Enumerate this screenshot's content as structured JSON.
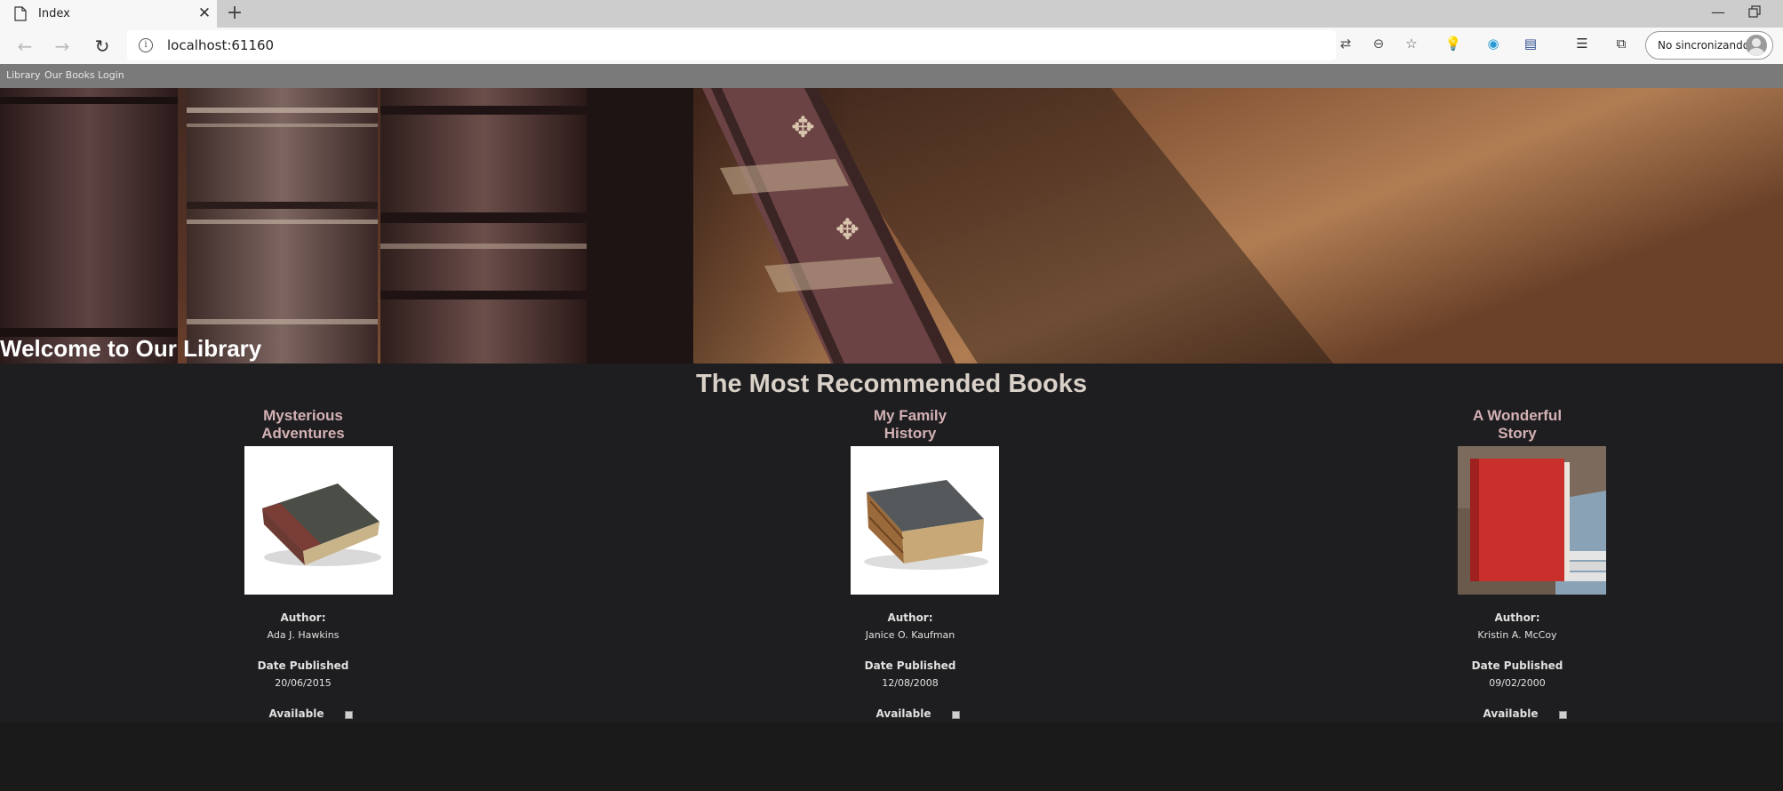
{
  "browser": {
    "tab_title": "Index",
    "url": "localhost:61160",
    "sync_label": "No sincronizando"
  },
  "site": {
    "nav": [
      {
        "label": "Library"
      },
      {
        "label": "Our Books"
      },
      {
        "label": "Login"
      }
    ],
    "hero_title": "Welcome to Our Library",
    "section_title": "The Most Recommended Books",
    "author_label": "Author:",
    "date_label": "Date Published",
    "available_label": "Available"
  },
  "books": [
    {
      "title_line1": "Mysterious",
      "title_line2": "Adventures",
      "author": "Ada J. Hawkins",
      "date": "20/06/2015",
      "cover": "old-dark-book"
    },
    {
      "title_line1": "My Family",
      "title_line2": "History",
      "author": "Janice O. Kaufman",
      "date": "12/08/2008",
      "cover": "old-brown-book"
    },
    {
      "title_line1": "A Wonderful",
      "title_line2": "Story",
      "author": "Kristin A. McCoy",
      "date": "09/02/2000",
      "cover": "red-book"
    }
  ]
}
